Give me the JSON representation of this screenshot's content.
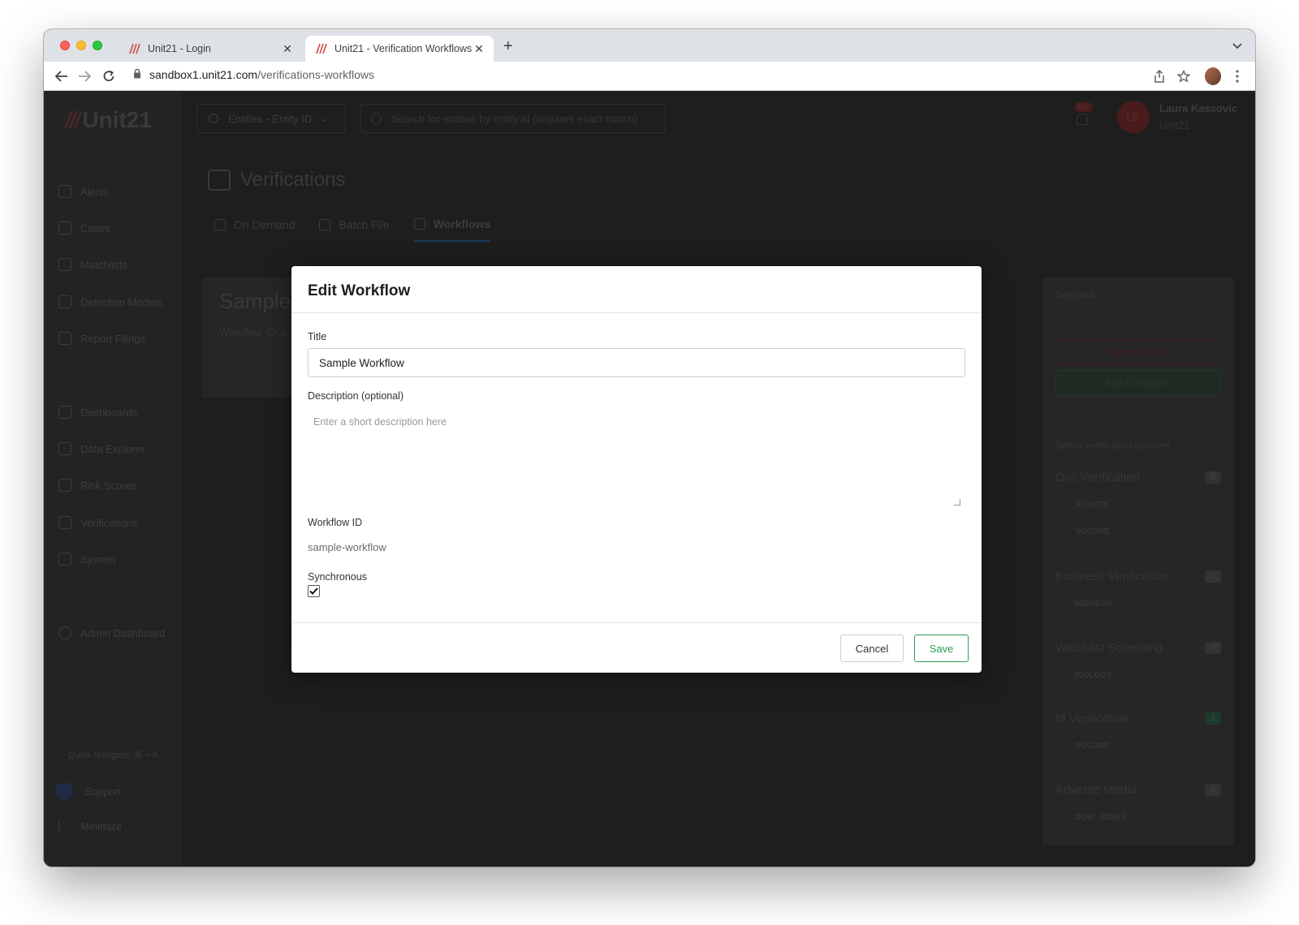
{
  "browser": {
    "tabs": [
      {
        "title": "Unit21 - Login",
        "active": false
      },
      {
        "title": "Unit21 - Verification Workflows",
        "active": true
      }
    ],
    "url_host": "sandbox1.unit21.com",
    "url_path": "/verifications-workflows"
  },
  "app": {
    "logo_text": "Unit21",
    "sidebar": {
      "items": [
        {
          "label": "Alerts",
          "icon": "flag-icon"
        },
        {
          "label": "Cases",
          "icon": "briefcase-icon"
        },
        {
          "label": "Matchlists",
          "icon": "user-list-icon"
        },
        {
          "label": "Detection Models",
          "icon": "scale-icon"
        },
        {
          "label": "Report Filings",
          "icon": "bank-icon"
        },
        {
          "label": "Dashboards",
          "icon": "chart-icon"
        },
        {
          "label": "Data Explorer",
          "icon": "search-list-icon"
        },
        {
          "label": "Risk Scores",
          "icon": "warning-icon"
        },
        {
          "label": "Verifications",
          "icon": "id-card-icon"
        },
        {
          "label": "System",
          "icon": "gear-icon"
        },
        {
          "label": "Admin Dashboard",
          "icon": "globe-icon"
        }
      ],
      "quick_navigate": "Quick Navigate: ⌘ + K",
      "support": "Support",
      "minimize": "Minimize"
    },
    "topbar": {
      "entity_dropdown": "Entities - Entity ID",
      "search_placeholder": "Search for entities by entity id (requires exact match)",
      "notification_badge": "99+",
      "user_initials": "LK",
      "user_name": "Laura Kassovic",
      "user_org": "Unit21"
    },
    "page_title": "Verifications",
    "tabs": [
      {
        "label": "On Demand",
        "selected": false
      },
      {
        "label": "Batch File",
        "selected": false
      },
      {
        "label": "Workflows",
        "selected": true
      }
    ],
    "workflow_card": {
      "title": "Sample",
      "subtitle": "Workflow ID: s"
    },
    "right_panel": {
      "selected_label": "Selected:",
      "remove_link": "Remove Link",
      "edit_conditions": "Edit Conditions",
      "services_label": "Select verification services",
      "services": [
        {
          "name": "Doc Verification",
          "count": "0",
          "providers": [
            "AU10TIX",
            "SOCURE"
          ]
        },
        {
          "name": "Business Verification",
          "count": "0",
          "providers": [
            "MIDDESK"
          ]
        },
        {
          "name": "Watchlist Screening",
          "count": "0",
          "providers": [
            "IDOLOGY"
          ]
        },
        {
          "name": "Id Verification",
          "count": "1",
          "providers": [
            "SOCURE"
          ]
        },
        {
          "name": "Adverse Media",
          "count": "0",
          "providers": [
            "DOW_JONES"
          ]
        }
      ]
    }
  },
  "modal": {
    "title": "Edit Workflow",
    "title_label": "Title",
    "title_value": "Sample Workflow",
    "description_label": "Description (optional)",
    "description_placeholder": "Enter a short description here",
    "workflow_id_label": "Workflow ID",
    "workflow_id_value": "sample-workflow",
    "synchronous_label": "Synchronous",
    "synchronous_checked": true,
    "cancel_label": "Cancel",
    "save_label": "Save"
  },
  "colors": {
    "save_green": "#2e9a52",
    "brand_red": "#c8102e"
  }
}
